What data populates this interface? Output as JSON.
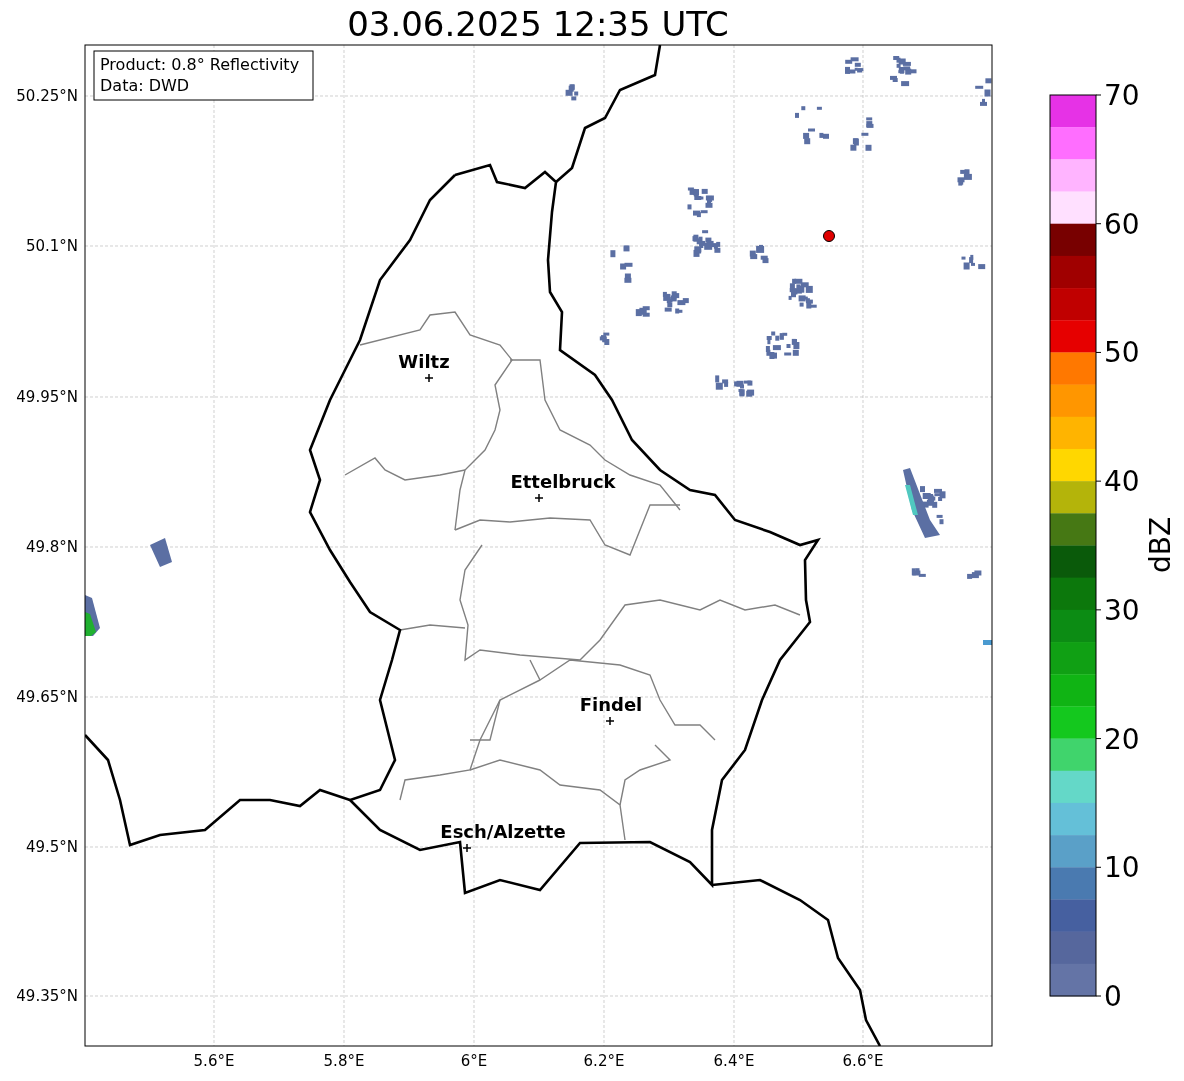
{
  "title": "03.06.2025 12:35 UTC",
  "info_box": [
    "Product: 0.8° Reflectivity",
    "Data: DWD"
  ],
  "cities": [
    {
      "name": "Wiltz"
    },
    {
      "name": "Ettelbruck"
    },
    {
      "name": "Findel"
    },
    {
      "name": "Esch/Alzette"
    }
  ],
  "lat_ticks": [
    "50.25°N",
    "50.1°N",
    "49.95°N",
    "49.8°N",
    "49.65°N",
    "49.5°N",
    "49.35°N"
  ],
  "lon_ticks": [
    "5.6°E",
    "5.8°E",
    "6°E",
    "6.2°E",
    "6.4°E",
    "6.6°E"
  ],
  "colorbar": {
    "label": "dBZ",
    "ticks": [
      "70",
      "60",
      "50",
      "40",
      "30",
      "20",
      "10",
      "0"
    ],
    "bands": [
      {
        "color": "#e632e6"
      },
      {
        "color": "#ff6eff"
      },
      {
        "color": "#ffb4ff"
      },
      {
        "color": "#ffe0ff"
      },
      {
        "color": "#780000"
      },
      {
        "color": "#a00000"
      },
      {
        "color": "#c00000"
      },
      {
        "color": "#e60000"
      },
      {
        "color": "#ff7800"
      },
      {
        "color": "#ff9600"
      },
      {
        "color": "#ffb400"
      },
      {
        "color": "#ffd700"
      },
      {
        "color": "#b4b40a"
      },
      {
        "color": "#467814"
      },
      {
        "color": "#0a5a0a"
      },
      {
        "color": "#0c780c"
      },
      {
        "color": "#0c8c14"
      },
      {
        "color": "#10a014"
      },
      {
        "color": "#10b414"
      },
      {
        "color": "#14c81e"
      },
      {
        "color": "#40d46c"
      },
      {
        "color": "#64d8c8"
      },
      {
        "color": "#64c0d8"
      },
      {
        "color": "#5aa0c8"
      },
      {
        "color": "#4a7ab0"
      },
      {
        "color": "#4660a0"
      },
      {
        "color": "#56679d"
      },
      {
        "color": "#6474a6"
      }
    ]
  }
}
